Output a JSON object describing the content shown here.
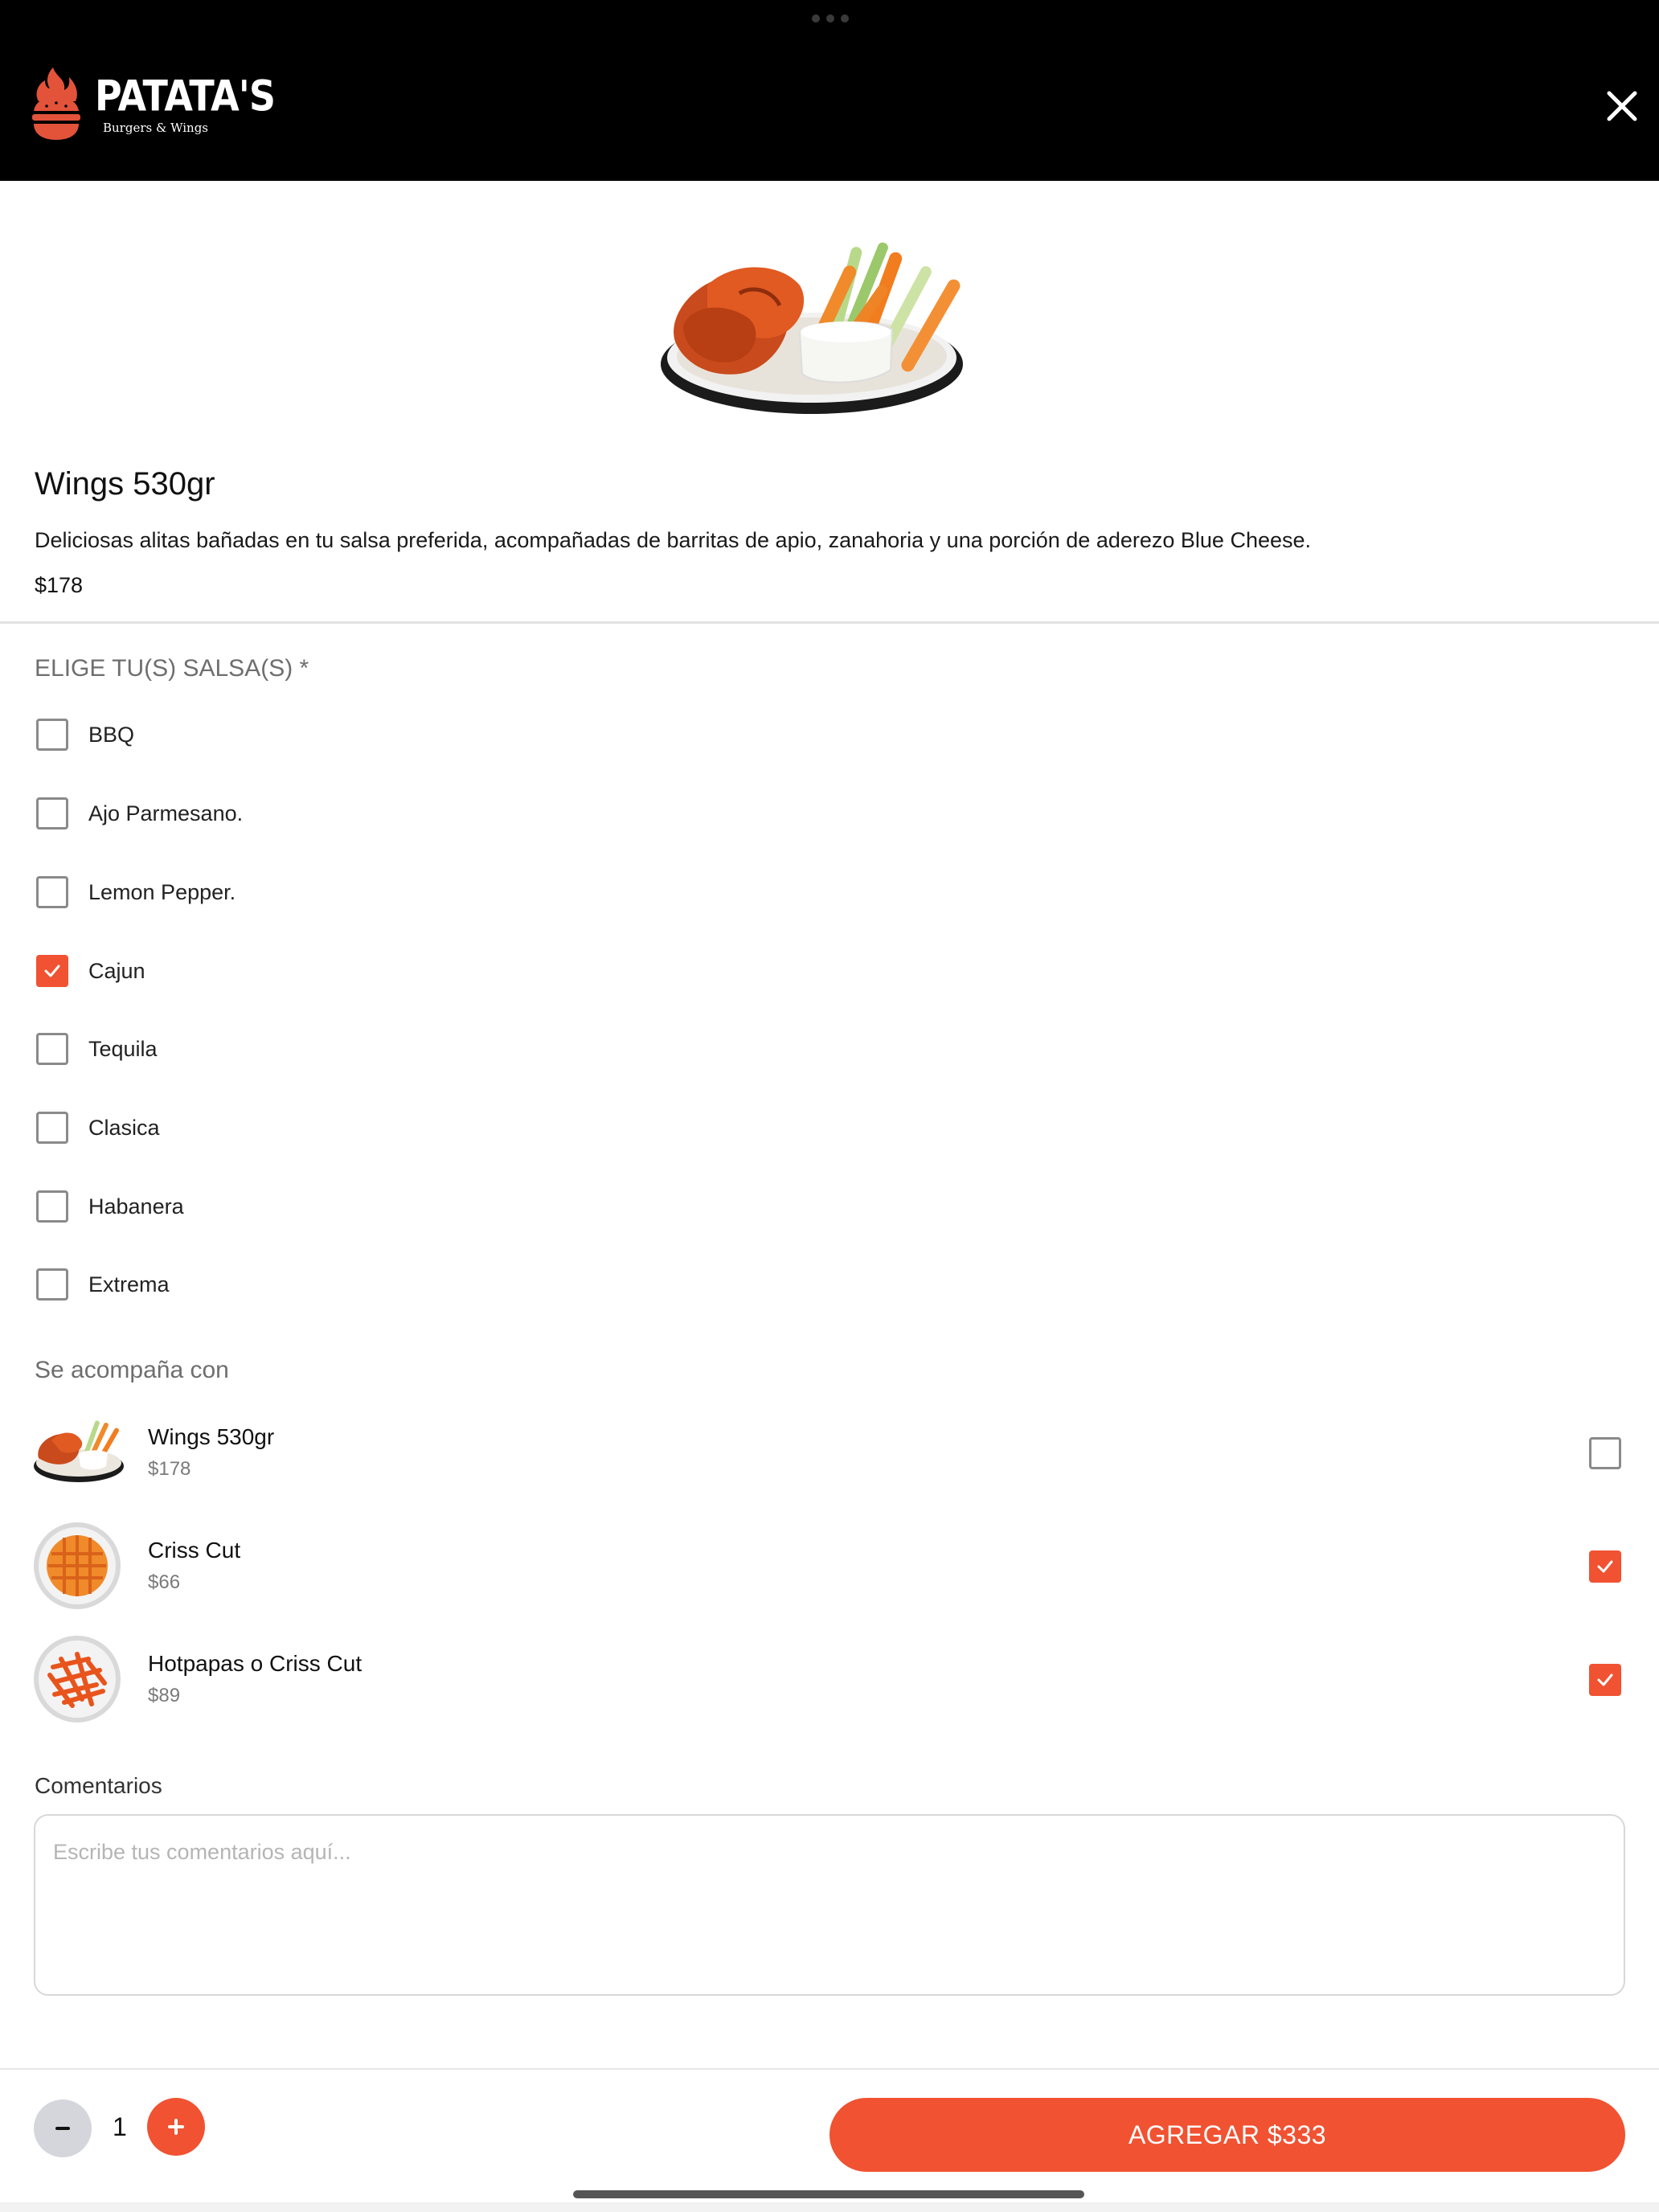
{
  "header": {
    "brand_name": "PATATA'S",
    "brand_sub": "Burgers & Wings"
  },
  "product": {
    "title": "Wings 530gr",
    "description": "Deliciosas alitas bañadas en tu salsa preferida, acompañadas de barritas de apio, zanahoria y una porción de aderezo Blue Cheese.",
    "price": "$178"
  },
  "sauces": {
    "title": "ELIGE TU(S) SALSA(S) *",
    "items": [
      {
        "label": "BBQ",
        "checked": false
      },
      {
        "label": "Ajo Parmesano.",
        "checked": false
      },
      {
        "label": "Lemon Pepper.",
        "checked": false
      },
      {
        "label": "Cajun",
        "checked": true
      },
      {
        "label": "Tequila",
        "checked": false
      },
      {
        "label": "Clasica",
        "checked": false
      },
      {
        "label": "Habanera",
        "checked": false
      },
      {
        "label": "Extrema",
        "checked": false
      }
    ]
  },
  "sides": {
    "title": "Se acompaña con",
    "items": [
      {
        "name": "Wings 530gr",
        "price": "$178",
        "checked": false,
        "thumb": "wings"
      },
      {
        "name": "Criss Cut",
        "price": "$66",
        "checked": true,
        "thumb": "criss-cut"
      },
      {
        "name": "Hotpapas o Criss Cut",
        "price": "$89",
        "checked": true,
        "thumb": "hotpapas"
      }
    ]
  },
  "comments": {
    "label": "Comentarios",
    "placeholder": "Escribe tus comentarios aquí...",
    "value": ""
  },
  "footer": {
    "quantity": "1",
    "add_label": "AGREGAR $333"
  },
  "colors": {
    "accent": "#f05232",
    "header_bg": "#000000"
  },
  "icons": {
    "close": "close-icon",
    "check": "check-icon",
    "minus": "minus-icon",
    "plus": "plus-icon"
  }
}
